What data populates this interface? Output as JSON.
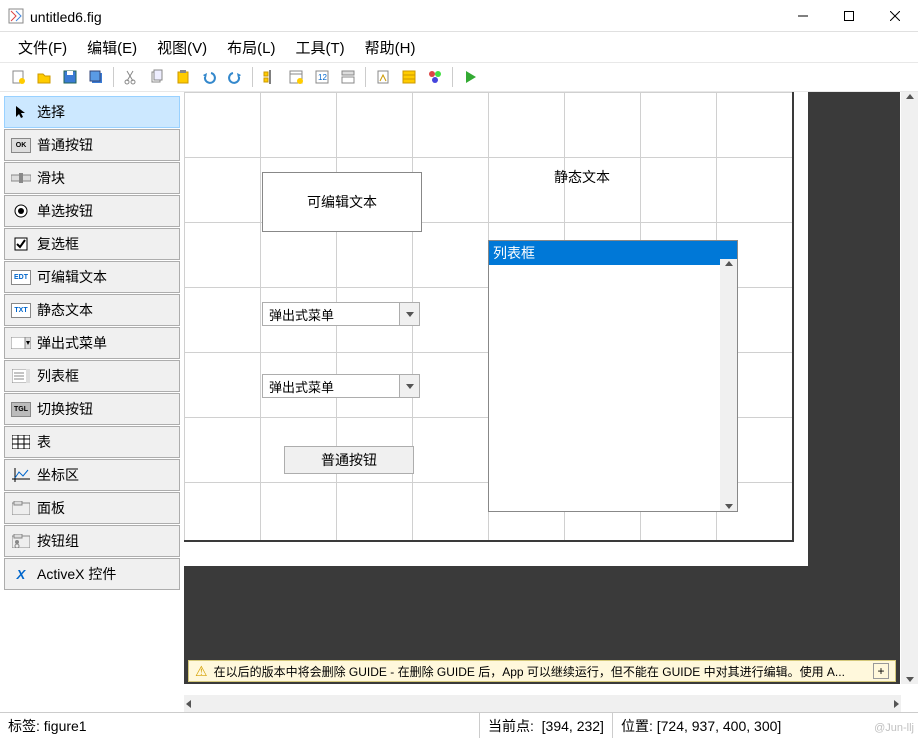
{
  "window": {
    "title": "untitled6.fig"
  },
  "menu": {
    "file": "文件(F)",
    "edit": "编辑(E)",
    "view": "视图(V)",
    "layout": "布局(L)",
    "tools": "工具(T)",
    "help": "帮助(H)"
  },
  "palette": {
    "select": "选择",
    "pushbutton": "普通按钮",
    "slider": "滑块",
    "radio": "单选按钮",
    "checkbox": "复选框",
    "edit": "可编辑文本",
    "static": "静态文本",
    "popup": "弹出式菜单",
    "listbox": "列表框",
    "toggle": "切换按钮",
    "table": "表",
    "axes": "坐标区",
    "panel": "面板",
    "buttongroup": "按钮组",
    "activex": "ActiveX 控件",
    "icon_ok": "OK",
    "icon_edt": "EDT",
    "icon_txt": "TXT",
    "icon_tgl": "TGL",
    "icon_x": "X"
  },
  "canvas": {
    "edit_text": "可编辑文本",
    "static_text": "静态文本",
    "popup1": "弹出式菜单",
    "popup2": "弹出式菜单",
    "button": "普通按钮",
    "listbox_item": "列表框"
  },
  "warning": {
    "text": "在以后的版本中将会删除 GUIDE - 在删除 GUIDE 后，App 可以继续运行，但不能在 GUIDE 中对其进行编辑。使用 A...",
    "expand": "+"
  },
  "status": {
    "tag_label": "标签:",
    "tag_value": "figure1",
    "current_label": "当前点:",
    "current_value": "[394, 232]",
    "position_label": "位置:",
    "position_value": "[724, 937, 400, 300]"
  },
  "watermark": "@Jun-llj"
}
